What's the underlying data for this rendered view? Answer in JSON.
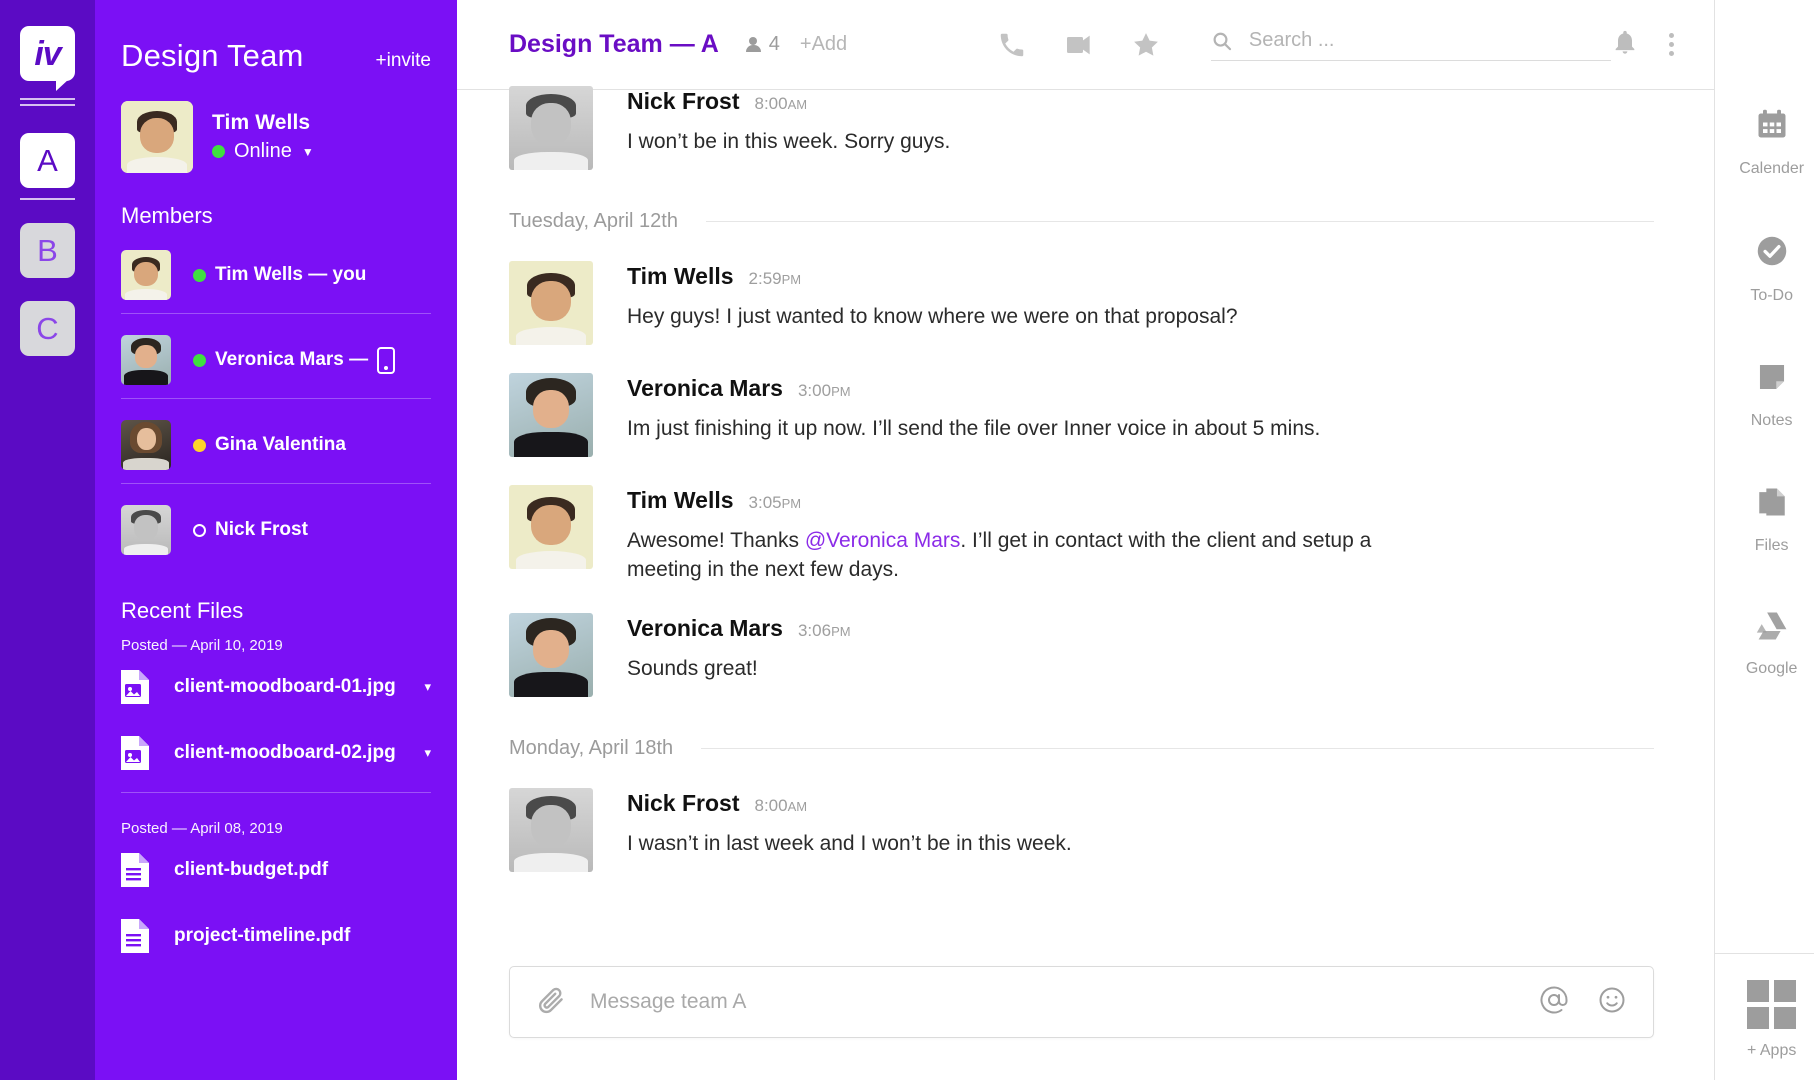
{
  "rail": {
    "logo_glyph": "iv",
    "workspaces": [
      {
        "label": "A",
        "state": "active"
      },
      {
        "label": "B",
        "state": "idle"
      },
      {
        "label": "C",
        "state": "idle"
      }
    ]
  },
  "sidebar": {
    "title": "Design Team",
    "invite_label": "+invite",
    "current_user": {
      "name": "Tim Wells",
      "status": "Online",
      "status_color": "#3FE03F",
      "avatar": "tim"
    },
    "members_heading": "Members",
    "members": [
      {
        "name": "Tim Wells — you",
        "presence": "green",
        "avatar": "tim",
        "device": ""
      },
      {
        "name": "Veronica Mars —",
        "presence": "green",
        "avatar": "ver",
        "device": "phone"
      },
      {
        "name": "Gina Valentina",
        "presence": "yellow",
        "avatar": "gina",
        "device": ""
      },
      {
        "name": "Nick Frost",
        "presence": "ring",
        "avatar": "nick",
        "device": ""
      }
    ],
    "files_heading": "Recent Files",
    "file_groups": [
      {
        "posted": "Posted — April 10, 2019",
        "files": [
          {
            "name": "client-moodboard-01.jpg",
            "icon": "image-file-icon",
            "caret": "▾"
          },
          {
            "name": "client-moodboard-02.jpg",
            "icon": "image-file-icon",
            "caret": "▾"
          }
        ]
      },
      {
        "posted": "Posted — April 08, 2019",
        "files": [
          {
            "name": "client-budget.pdf",
            "icon": "doc-file-icon",
            "caret": ""
          },
          {
            "name": "project-timeline.pdf",
            "icon": "doc-file-icon",
            "caret": ""
          }
        ]
      }
    ]
  },
  "topbar": {
    "room_title": "Design Team — A",
    "member_count": "4",
    "add_label": "+Add",
    "icons": [
      "phone-icon",
      "video-camera-icon",
      "star-icon"
    ],
    "search_placeholder": "Search ...",
    "search_value": "",
    "right_icons": [
      "bell-icon",
      "kebab-menu-icon"
    ]
  },
  "conversation": {
    "items": [
      {
        "type": "message",
        "author": "Nick Frost",
        "time": "8:00",
        "ampm": "AM",
        "avatar": "nick",
        "text": "I won’t be in this week. Sorry guys."
      },
      {
        "type": "divider",
        "label": "Tuesday, April 12th"
      },
      {
        "type": "message",
        "author": "Tim Wells",
        "time": "2:59",
        "ampm": "PM",
        "avatar": "tim",
        "text": "Hey guys! I just wanted to know where we were on that proposal?"
      },
      {
        "type": "message",
        "author": "Veronica Mars",
        "time": "3:00",
        "ampm": "PM",
        "avatar": "ver",
        "text": "Im just finishing it up now. I’ll send the file over Inner voice in about 5 mins."
      },
      {
        "type": "message",
        "author": "Tim Wells",
        "time": "3:05",
        "ampm": "PM",
        "avatar": "tim",
        "text_before": "Awesome! Thanks ",
        "mention": "@Veronica Mars",
        "text_after": ". I’ll get in contact with the client and setup a meeting in the next few days."
      },
      {
        "type": "message",
        "author": "Veronica Mars",
        "time": "3:06",
        "ampm": "PM",
        "avatar": "ver",
        "text": "Sounds great!"
      },
      {
        "type": "divider",
        "label": "Monday, April 18th"
      },
      {
        "type": "message",
        "author": "Nick Frost",
        "time": "8:00",
        "ampm": "AM",
        "avatar": "nick",
        "text": "I wasn’t in last week and I won’t be in this week."
      }
    ]
  },
  "composer": {
    "placeholder": "Message team A",
    "value": "",
    "attach_icon": "paperclip-icon",
    "mention_icon": "at-sign-icon",
    "emoji_icon": "smiley-icon"
  },
  "rightbar": {
    "apps": [
      {
        "label": "Calender",
        "icon": "calendar-icon"
      },
      {
        "label": "To-Do",
        "icon": "check-circle-icon"
      },
      {
        "label": "Notes",
        "icon": "note-icon"
      },
      {
        "label": "Files",
        "icon": "files-icon"
      },
      {
        "label": "Google",
        "icon": "google-drive-icon"
      }
    ],
    "add_apps_label": "+ Apps"
  },
  "colors": {
    "rail_purple": "#5B0BC4",
    "sidebar_purple": "#7B10F5",
    "title_purple": "#6A0DC4",
    "mention_purple": "#8B2BE8",
    "online_green": "#3FE03F",
    "away_yellow": "#FFD42A",
    "muted_gray": "#9D9D9D"
  }
}
